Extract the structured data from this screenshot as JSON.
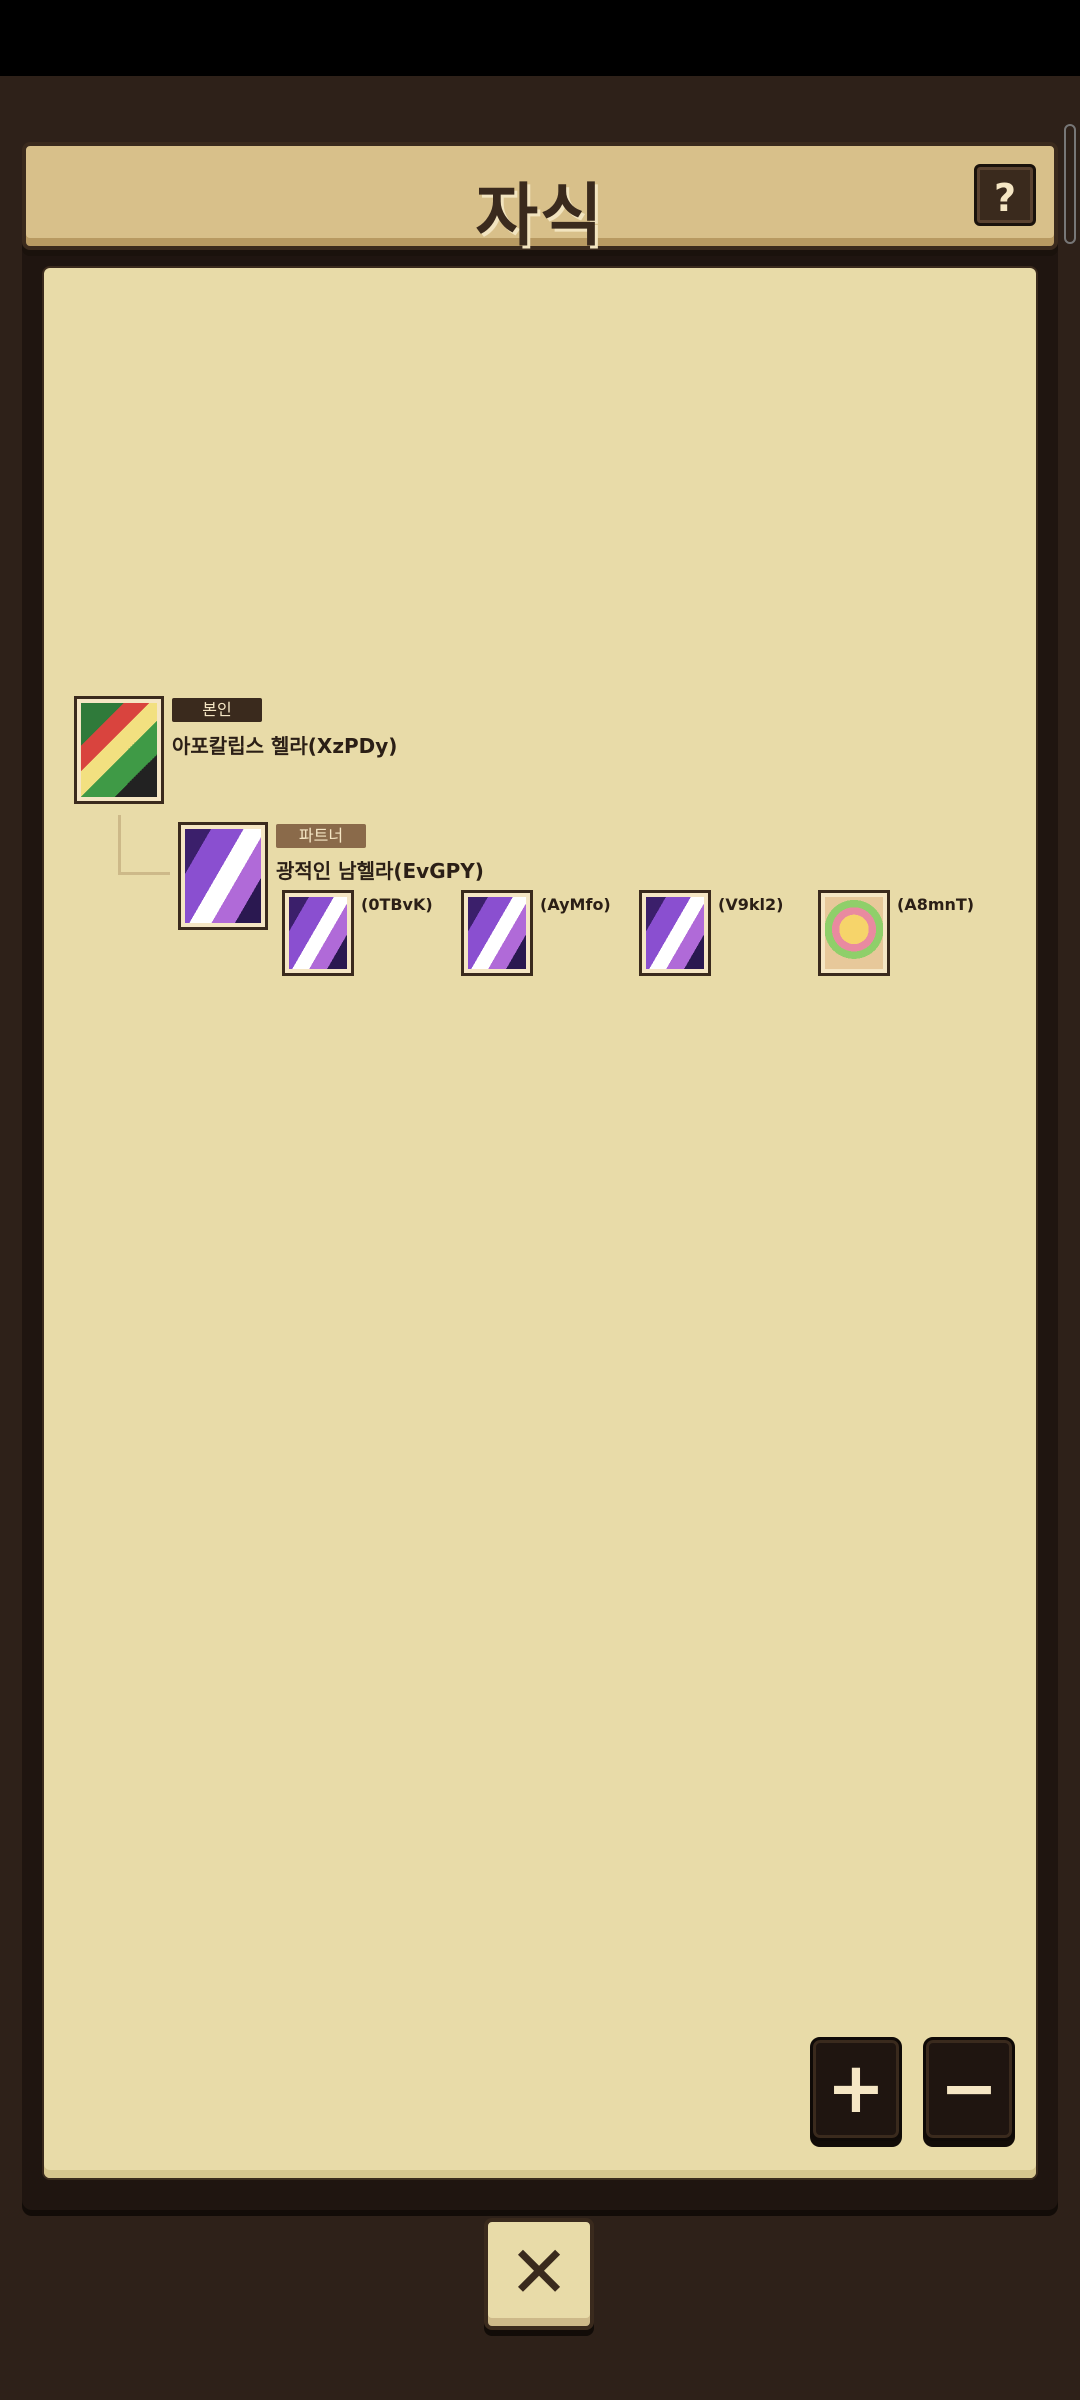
{
  "header": {
    "title": "자식",
    "help_label": "?"
  },
  "tree": {
    "self": {
      "tag": "본인",
      "name": "아포칼립스 헬라(XzPDy)"
    },
    "partner": {
      "tag": "파트너",
      "name": "광적인 남헬라(EvGPY)"
    },
    "children": [
      {
        "label": "(0TBvK)",
        "art": "purple-dragon"
      },
      {
        "label": "(AyMfo)",
        "art": "purple-dragon"
      },
      {
        "label": "(V9kl2)",
        "art": "purple-dragon"
      },
      {
        "label": "(A8mnT)",
        "art": "yellow-creature"
      }
    ]
  },
  "controls": {
    "zoom_in_label": "+",
    "zoom_out_label": "−",
    "close_label": "✕"
  }
}
